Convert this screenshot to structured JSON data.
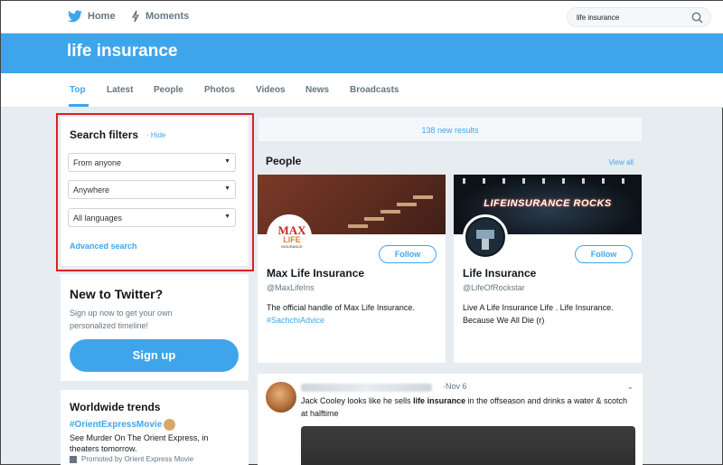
{
  "topnav": {
    "home_label": "Home",
    "moments_label": "Moments",
    "search_value": "life insurance"
  },
  "banner": {
    "title": "life insurance"
  },
  "tabs": [
    {
      "label": "Top",
      "active": true
    },
    {
      "label": "Latest"
    },
    {
      "label": "People"
    },
    {
      "label": "Photos"
    },
    {
      "label": "Videos"
    },
    {
      "label": "News"
    },
    {
      "label": "Broadcasts"
    }
  ],
  "filters": {
    "title": "Search filters",
    "hide_label": "· Hide",
    "from": "From anyone",
    "where": "Anywhere",
    "language": "All languages",
    "advanced": "Advanced search"
  },
  "signup_card": {
    "title": "New to Twitter?",
    "description": "Sign up now to get your own personalized timeline!",
    "button": "Sign up"
  },
  "trends": {
    "title": "Worldwide trends",
    "tag": "#OrientExpressMovie",
    "description": "See Murder On The Orient Express, in theaters tomorrow.",
    "promoted": "Promoted by Orient Express Movie"
  },
  "results": {
    "new_label": "138 new results"
  },
  "people": {
    "title": "People",
    "view_all": "View all",
    "cards": [
      {
        "name": "Max Life Insurance",
        "handle": "@MaxLifeIns",
        "bio": "The official handle of Max Life Insurance.",
        "bio_tag": "#SachchiAdvice",
        "follow": "Follow",
        "logo_top": "MAX",
        "logo_mid": "LIFE",
        "logo_small": "INSURANCE"
      },
      {
        "name": "Life Insurance",
        "handle": "@LifeOfRockstar",
        "bio": "Live A Life Insurance Life . Life Insurance. Because We All Die (r)",
        "follow": "Follow",
        "banner_text": "LIFEINSURANCE ROCKS"
      }
    ]
  },
  "tweet": {
    "date": "·Nov 6",
    "text_before": "Jack Cooley looks like he sells ",
    "text_bold": "life insurance",
    "text_after": " in the offseason and drinks a water & scotch at halftime"
  },
  "colors": {
    "accent": "#3fa5eb",
    "highlight_outline": "#e02020"
  }
}
